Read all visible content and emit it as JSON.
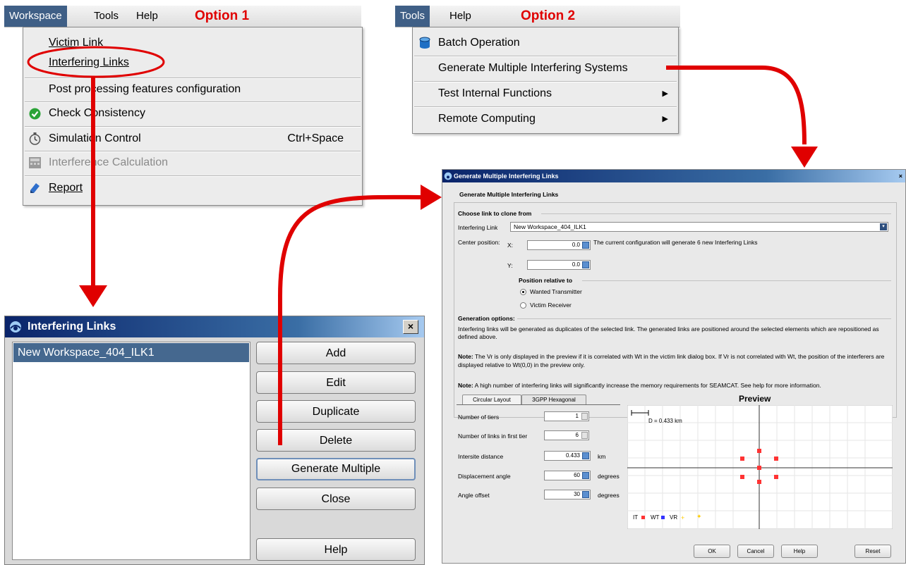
{
  "option1": {
    "label": "Option 1",
    "menubar": [
      "Workspace",
      "Tools",
      "Help"
    ],
    "items": {
      "victim_link": "Victim Link",
      "interfering_links": "Interfering Links",
      "post_processing": "Post processing features configuration",
      "check_consistency": "Check Consistency",
      "simulation_control": "Simulation Control",
      "simulation_shortcut": "Ctrl+Space",
      "interference_calculation": "Interference Calculation",
      "report": "Report"
    }
  },
  "option2": {
    "label": "Option 2",
    "menubar": [
      "Tools",
      "Help"
    ],
    "items": {
      "batch_operation": "Batch Operation",
      "generate_multiple": "Generate Multiple Interfering Systems",
      "test_internal": "Test Internal Functions",
      "remote_computing": "Remote Computing"
    },
    "submenu_arrow": "▶"
  },
  "interfering_links_dialog": {
    "title": "Interfering Links",
    "close": "×",
    "list_items": [
      "New Workspace_404_ILK1"
    ],
    "buttons": {
      "add": "Add",
      "edit": "Edit",
      "duplicate": "Duplicate",
      "delete": "Delete",
      "generate_multiple": "Generate Multiple",
      "close": "Close",
      "help": "Help"
    }
  },
  "generate_dialog": {
    "title": "Generate Multiple Interfering Links",
    "close": "×",
    "heading": "Generate Multiple Interfering Links",
    "choose_link": "Choose link to clone from",
    "interfering_link_label": "Interfering Link",
    "interfering_link_value": "New Workspace_404_ILK1",
    "center_position_label": "Center position:",
    "x_label": "X:",
    "y_label": "Y:",
    "x_value": "0.0",
    "y_value": "0.0",
    "config_note": "The current configuration will generate 6 new Interfering Links",
    "position_relative_to": "Position relative to",
    "radio_wanted": "Wanted Transmitter",
    "radio_victim": "Victim Receiver",
    "generation_options": "Generation options:",
    "gen_text": "Interfering links will be generated as duplicates of the selected link. The generated links are positioned around the selected elements which are repositioned as defined above.",
    "note1_label": "Note:",
    "note1_text": "The Vr is only displayed in the preview if it is correlated with Wt in the victim link dialog box. If Vr is not correlated with Wt, the position of the interferers are displayed relative to Wt(0,0) in the preview only.",
    "note2_label": "Note:",
    "note2_text": "A high number of interfering links will significantly increase the memory requirements for SEAMCAT. See help for more information.",
    "tabs": [
      "Circular Layout",
      "3GPP Hexagonal"
    ],
    "params": {
      "tiers_label": "Number of tiers",
      "tiers_value": "1",
      "links_first_tier_label": "Number of links in first tier",
      "links_first_tier_value": "6",
      "intersite_label": "Intersite distance",
      "intersite_value": "0.433",
      "intersite_unit": "km",
      "displacement_label": "Displacement angle",
      "displacement_value": "60",
      "displacement_unit": "degrees",
      "offset_label": "Angle offset",
      "offset_value": "30",
      "offset_unit": "degrees"
    },
    "preview": {
      "title": "Preview",
      "scale_label": "D = 0.433 km",
      "legend": [
        "IT",
        "WT",
        "VR"
      ],
      "colors": {
        "it": "#ff3333",
        "wt": "#3333ff",
        "vr": "#ffcc00"
      }
    },
    "buttons": {
      "ok": "OK",
      "cancel": "Cancel",
      "help": "Help",
      "reset": "Reset"
    }
  },
  "colors": {
    "annotation_red": "#e00000",
    "menu_highlight": "#3f5f86"
  }
}
